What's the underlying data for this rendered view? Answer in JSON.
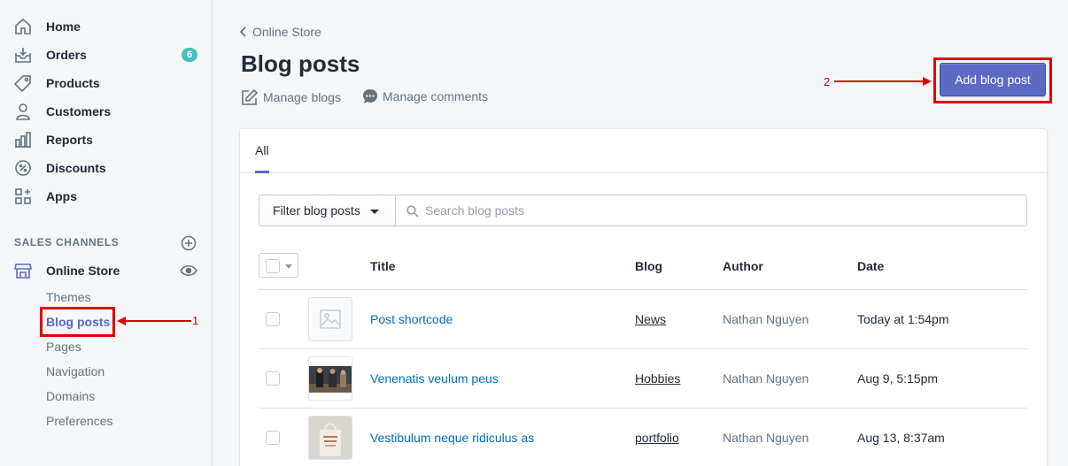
{
  "sidebar": {
    "nav": [
      {
        "label": "Home",
        "icon": "home-icon"
      },
      {
        "label": "Orders",
        "icon": "orders-icon",
        "badge": "6"
      },
      {
        "label": "Products",
        "icon": "tag-icon"
      },
      {
        "label": "Customers",
        "icon": "person-icon"
      },
      {
        "label": "Reports",
        "icon": "chart-icon"
      },
      {
        "label": "Discounts",
        "icon": "discount-icon"
      },
      {
        "label": "Apps",
        "icon": "apps-icon"
      }
    ],
    "sales_channels_title": "SALES CHANNELS",
    "online_store_label": "Online Store",
    "sub_items": [
      "Themes",
      "Blog posts",
      "Pages",
      "Navigation",
      "Domains",
      "Preferences"
    ],
    "active_sub_item": "Blog posts"
  },
  "annotations": {
    "first": "1",
    "second": "2",
    "color": "#e00000"
  },
  "main": {
    "breadcrumb": "Online Store",
    "title": "Blog posts",
    "manage_blogs": "Manage blogs",
    "manage_comments": "Manage comments",
    "add_button": "Add blog post",
    "tab_all": "All",
    "filter_label": "Filter blog posts",
    "search_placeholder": "Search blog posts",
    "columns": {
      "title": "Title",
      "blog": "Blog",
      "author": "Author",
      "date": "Date"
    },
    "rows": [
      {
        "title": "Post shortcode",
        "blog": "News",
        "author": "Nathan Nguyen",
        "date": "Today at 1:54pm",
        "thumb": "placeholder-image-icon"
      },
      {
        "title": "Venenatis veulum peus",
        "blog": "Hobbies",
        "author": "Nathan Nguyen",
        "date": "Aug 9, 5:15pm",
        "thumb": "people-photo"
      },
      {
        "title": "Vestibulum neque ridiculus as",
        "blog": "portfolio",
        "author": "Nathan Nguyen",
        "date": "Aug 13, 8:37am",
        "thumb": "tote-bag-photo"
      }
    ]
  },
  "colors": {
    "accent": "#5c6ac4",
    "link": "#006fbb",
    "badge": "#47c1bf"
  }
}
